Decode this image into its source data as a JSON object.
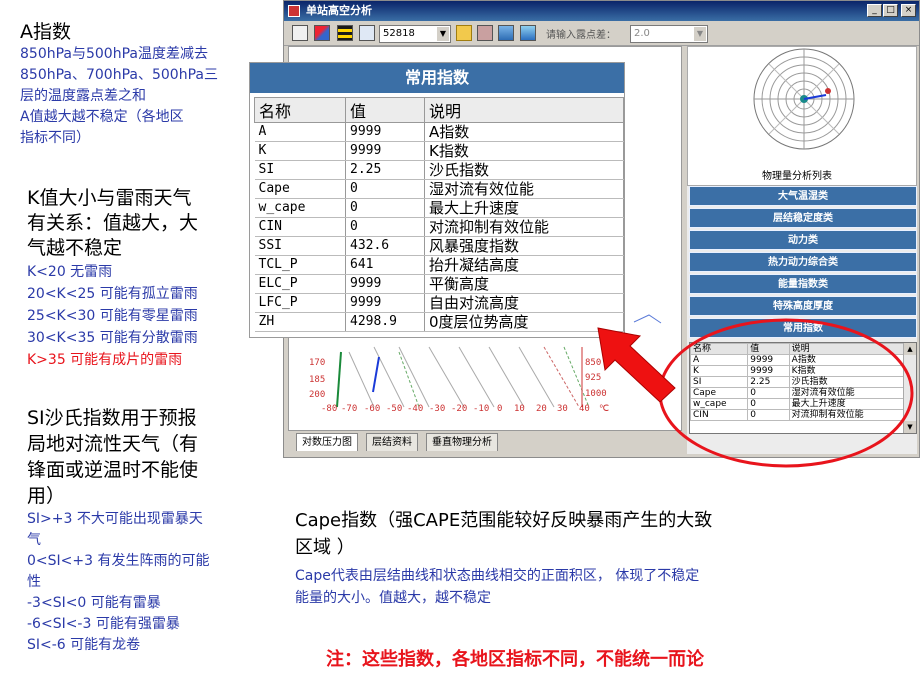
{
  "left": {
    "a_title": "A指数",
    "a_lines": [
      "850hPa与500hPa温度差减去",
      "850hPa、700hPa、500hPa三",
      "层的温度露点差之和",
      "A值越大越不稳定（各地区",
      "指标不同）"
    ],
    "k_title_lines": [
      "K值大小与雷雨天气",
      "有关系：值越大，大",
      "气越不稳定"
    ],
    "k_lines": [
      "K<20 无雷雨",
      "20<K<25 可能有孤立雷雨",
      "25<K<30 可能有零星雷雨",
      "30<K<35 可能有分散雷雨"
    ],
    "k_red_line": "K>35 可能有成片的雷雨",
    "si_title_lines": [
      "SI沙氏指数用于预报",
      "局地对流性天气（有",
      "锋面或逆温时不能使",
      "用）"
    ],
    "si_lines": [
      "SI>+3 不大可能出现雷暴天",
      "气",
      "0<SI<+3 有发生阵雨的可能",
      "性",
      "-3<SI<0 可能有雷暴",
      "-6<SI<-3 可能有强雷暴",
      "SI<-6 可能有龙卷"
    ]
  },
  "window": {
    "title": "单站高空分析",
    "station": "52818",
    "dew_label": "请输入露点差：",
    "dew_value": "2.0",
    "tabs": [
      "对数压力图",
      "层结资料",
      "垂直物理分析"
    ],
    "panel_caption": "物理量分析列表",
    "categories": [
      "大气温湿类",
      "层结稳定度类",
      "动力类",
      "热力动力综合类",
      "能量指数类",
      "特殊高度厚度",
      "常用指数"
    ],
    "plot_y_left": [
      "170",
      "185",
      "200"
    ],
    "plot_y_right": [
      "850",
      "925",
      "1000"
    ],
    "plot_x_ticks": [
      "-80",
      "-70",
      "-60",
      "-50",
      "-40",
      "-30",
      "-20",
      "-10",
      "0",
      "10",
      "20",
      "30",
      "40",
      "℃"
    ]
  },
  "mini_table": {
    "headers": [
      "名称",
      "值",
      "说明"
    ],
    "rows": [
      [
        "A",
        "9999",
        "A指数"
      ],
      [
        "K",
        "9999",
        "K指数"
      ],
      [
        "SI",
        "2.25",
        "沙氏指数"
      ],
      [
        "Cape",
        "0",
        "湿对流有效位能"
      ],
      [
        "w_cape",
        "0",
        "最大上升速度"
      ],
      [
        "CIN",
        "0",
        "对流抑制有效位能"
      ]
    ]
  },
  "big_table": {
    "title": "常用指数",
    "headers": [
      "名称",
      "值",
      "说明"
    ],
    "rows": [
      [
        "A",
        "9999",
        "A指数"
      ],
      [
        "K",
        "9999",
        "K指数"
      ],
      [
        "SI",
        "2.25",
        "沙氏指数"
      ],
      [
        "Cape",
        "0",
        "湿对流有效位能"
      ],
      [
        "w_cape",
        "0",
        "最大上升速度"
      ],
      [
        "CIN",
        "0",
        "对流抑制有效位能"
      ],
      [
        "SSI",
        "432.6",
        "风暴强度指数"
      ],
      [
        "TCL_P",
        "641",
        "抬升凝结高度"
      ],
      [
        "ELC_P",
        "9999",
        "平衡高度"
      ],
      [
        "LFC_P",
        "9999",
        "自由对流高度"
      ],
      [
        "ZH",
        "4298.9",
        "0度层位势高度"
      ]
    ]
  },
  "bottom": {
    "cape_title_lines": [
      "Cape指数（强CAPE范围能较好反映暴雨产生的大致",
      "区域 ）"
    ],
    "cape_desc_lines": [
      "Cape代表由层结曲线和状态曲线相交的正面积区， 体现了不稳定",
      "能量的大小。值越大，越不稳定"
    ],
    "note": "注：这些指数，各地区指标不同，不能统一而论"
  },
  "colors": {
    "accent_blue": "#3b6fa6",
    "text_blue": "#2b3aa8",
    "highlight_red": "#e8141c"
  }
}
